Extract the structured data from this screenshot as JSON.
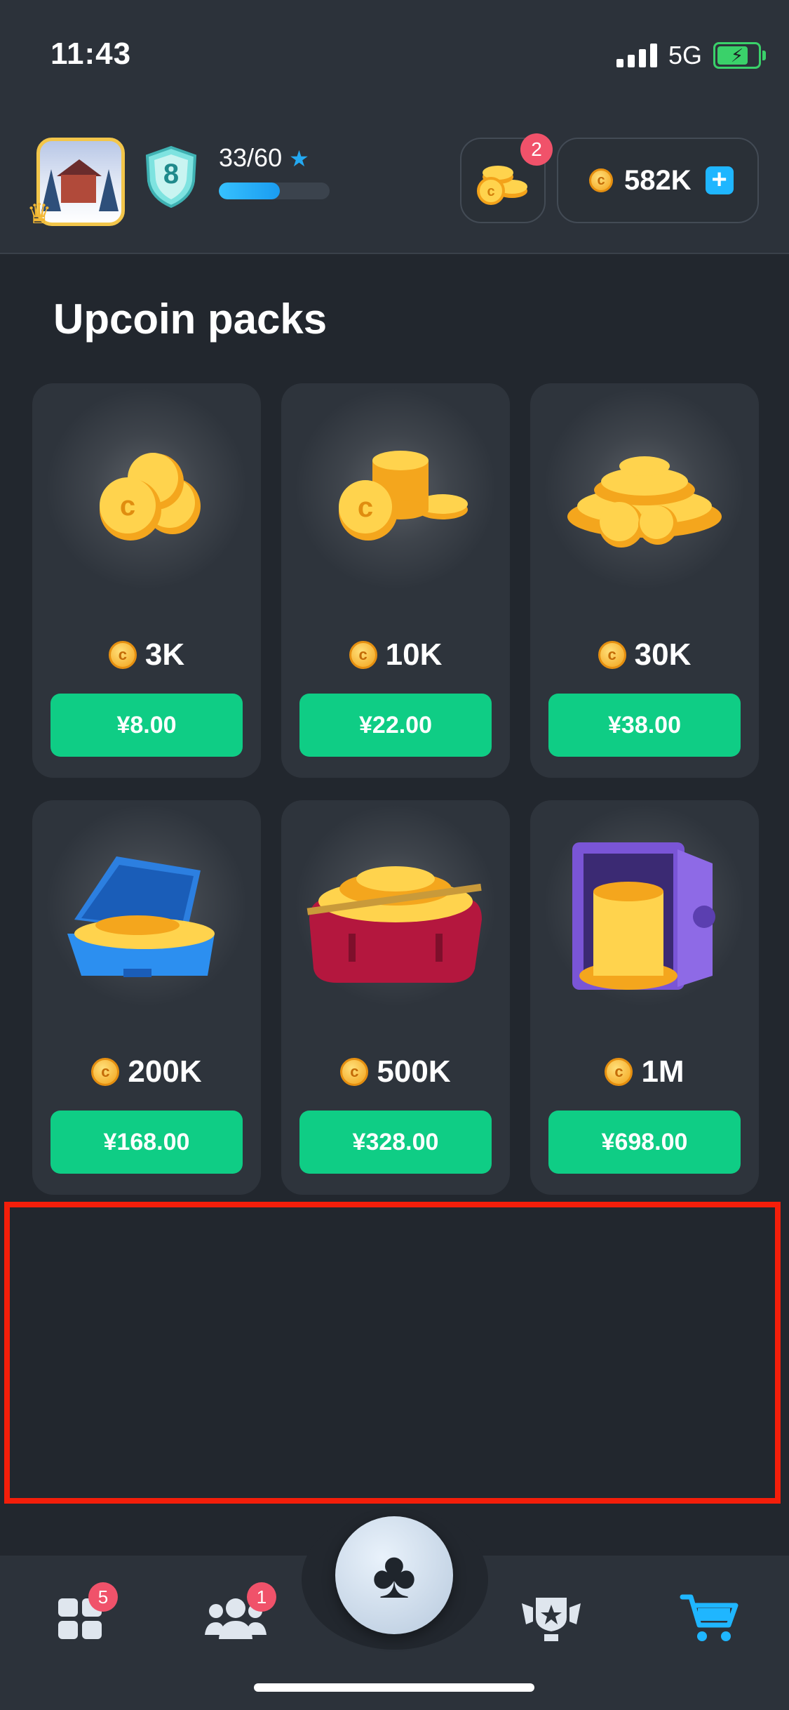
{
  "status_bar": {
    "time": "11:43",
    "network": "5G"
  },
  "profile": {
    "level": "8",
    "xp": "33/60",
    "xp_progress": 0.55
  },
  "header": {
    "free_coins_badge": "2",
    "coin_balance": "582K"
  },
  "shop": {
    "title": "Upcoin packs",
    "packs": [
      {
        "amount": "3K",
        "price": "¥8.00",
        "art": "coin-pile-small-icon"
      },
      {
        "amount": "10K",
        "price": "¥22.00",
        "art": "coin-stack-icon"
      },
      {
        "amount": "30K",
        "price": "¥38.00",
        "art": "coin-heap-icon"
      },
      {
        "amount": "200K",
        "price": "¥168.00",
        "art": "coin-case-icon"
      },
      {
        "amount": "500K",
        "price": "¥328.00",
        "art": "coin-bag-icon"
      },
      {
        "amount": "1M",
        "price": "¥698.00",
        "art": "coin-vault-icon"
      }
    ]
  },
  "nav": {
    "items": [
      {
        "name": "games",
        "badge": "5"
      },
      {
        "name": "friends",
        "badge": "1"
      },
      {
        "name": "play"
      },
      {
        "name": "leaderboard"
      },
      {
        "name": "shop",
        "active": true
      }
    ]
  },
  "colors": {
    "accent": "#0fcd85",
    "highlight": "#f41e0a",
    "active": "#1fb6ff"
  }
}
